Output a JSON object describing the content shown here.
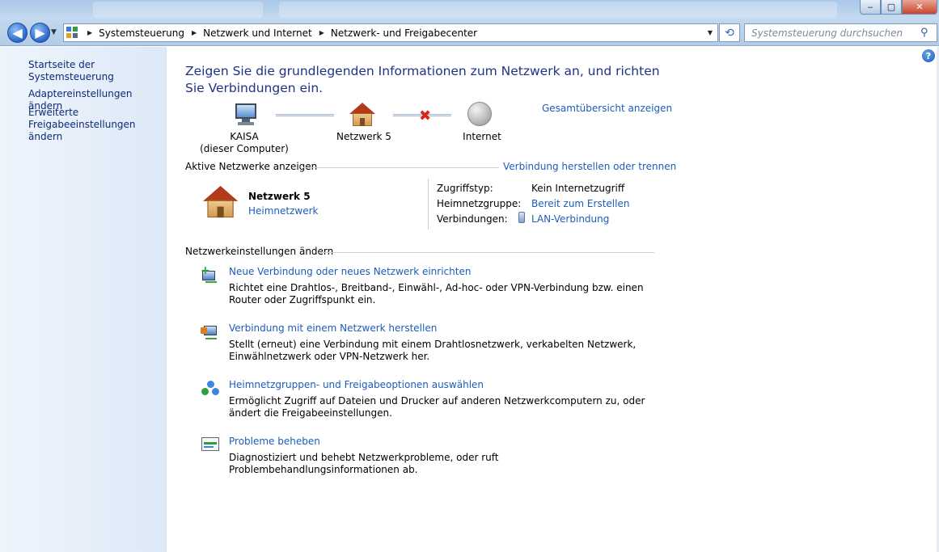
{
  "window": {
    "minimize_label": "‒",
    "maximize_label": "▢",
    "close_label": "✕"
  },
  "nav": {
    "back_label": "◀",
    "forward_label": "▶",
    "breadcrumbs": [
      "Systemsteuerung",
      "Netzwerk und Internet",
      "Netzwerk- und Freigabecenter"
    ],
    "search_placeholder": "Systemsteuerung durchsuchen"
  },
  "sidebar": {
    "items": [
      {
        "label": "Startseite der Systemsteuerung"
      },
      {
        "label": "Adaptereinstellungen ändern"
      },
      {
        "label": "Erweiterte Freigabeeinstellungen ändern"
      }
    ]
  },
  "main": {
    "title": "Zeigen Sie die grundlegenden Informationen zum Netzwerk an, und richten Sie Verbindungen ein.",
    "overview_link": "Gesamtübersicht anzeigen",
    "map": {
      "computer_name": "KAISA",
      "computer_sub": "(dieser Computer)",
      "network_name": "Netzwerk  5",
      "internet": "Internet"
    },
    "active_networks": {
      "heading": "Aktive Netzwerke anzeigen",
      "connect_link": "Verbindung herstellen oder trennen",
      "network_name": "Netzwerk  5",
      "network_type": "Heimnetzwerk",
      "access_type_label": "Zugriffstyp:",
      "access_type_value": "Kein Internetzugriff",
      "homegroup_label": "Heimnetzgruppe:",
      "homegroup_value": "Bereit zum Erstellen",
      "connections_label": "Verbindungen:",
      "connections_value": "LAN-Verbindung"
    },
    "settings": {
      "heading": "Netzwerkeinstellungen ändern",
      "tasks": [
        {
          "link": "Neue Verbindung oder neues Netzwerk einrichten",
          "desc": "Richtet eine Drahtlos-, Breitband-, Einwähl-, Ad-hoc- oder VPN-Verbindung bzw. einen Router oder Zugriffspunkt ein."
        },
        {
          "link": "Verbindung mit einem Netzwerk herstellen",
          "desc": "Stellt (erneut) eine Verbindung mit einem Drahtlosnetzwerk, verkabelten Netzwerk, Einwählnetzwerk oder VPN-Netzwerk her."
        },
        {
          "link": "Heimnetzgruppen- und Freigabeoptionen auswählen",
          "desc": "Ermöglicht Zugriff auf Dateien und Drucker auf anderen Netzwerkcomputern zu, oder ändert die Freigabeeinstellungen."
        },
        {
          "link": "Probleme beheben",
          "desc": "Diagnostiziert und behebt Netzwerkprobleme, oder ruft Problembehandlungsinformationen ab."
        }
      ]
    }
  },
  "help_label": "?"
}
